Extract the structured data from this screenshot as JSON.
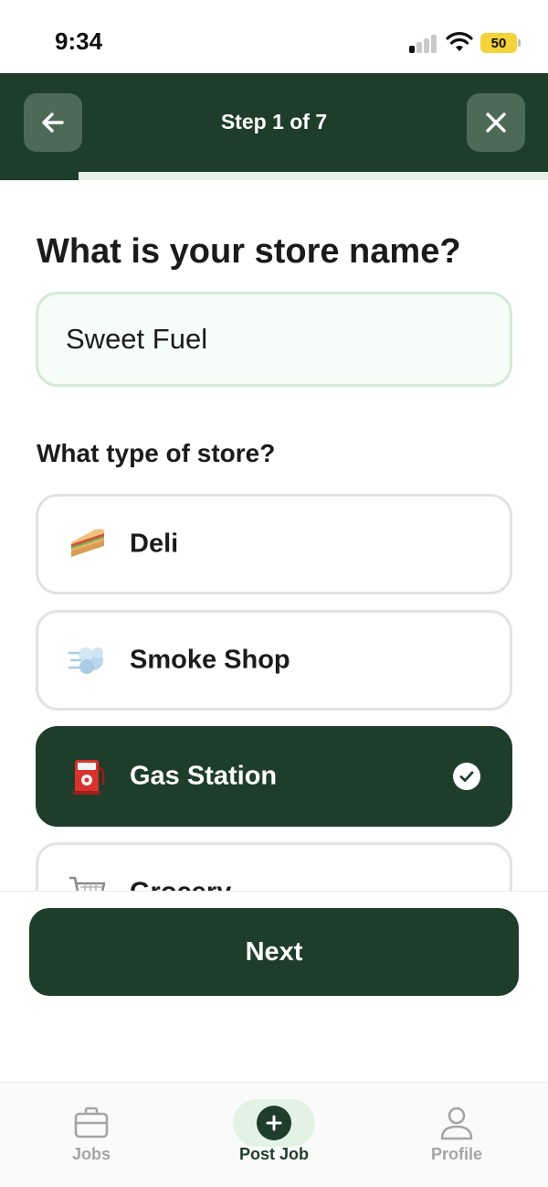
{
  "status_bar": {
    "time": "9:34",
    "battery_level": "50",
    "signal_bars_active": 1,
    "signal_bars_total": 4
  },
  "header": {
    "title": "Step 1 of 7",
    "back_icon": "arrow-left-icon",
    "close_icon": "close-icon",
    "progress_step": 1,
    "progress_total": 7
  },
  "form": {
    "store_name_question": "What is your store name?",
    "store_name_value": "Sweet Fuel",
    "store_type_question": "What type of store?",
    "store_types": [
      {
        "label": "Deli",
        "icon": "sandwich-icon",
        "selected": false
      },
      {
        "label": "Smoke Shop",
        "icon": "smoke-cloud-icon",
        "selected": false
      },
      {
        "label": "Gas Station",
        "icon": "fuel-pump-icon",
        "selected": true
      },
      {
        "label": "Grocery",
        "icon": "shopping-cart-icon",
        "selected": false
      }
    ]
  },
  "actions": {
    "next_label": "Next"
  },
  "tabbar": {
    "tabs": [
      {
        "label": "Jobs",
        "icon": "briefcase-icon",
        "active": false
      },
      {
        "label": "Post Job",
        "icon": "plus-circle-icon",
        "active": true
      },
      {
        "label": "Profile",
        "icon": "person-icon",
        "active": false
      }
    ]
  },
  "colors": {
    "brand_dark_green": "#1f3d2b",
    "progress_track": "#e4f1e7",
    "input_border": "#d4ead8",
    "battery_yellow": "#f4d23a"
  }
}
